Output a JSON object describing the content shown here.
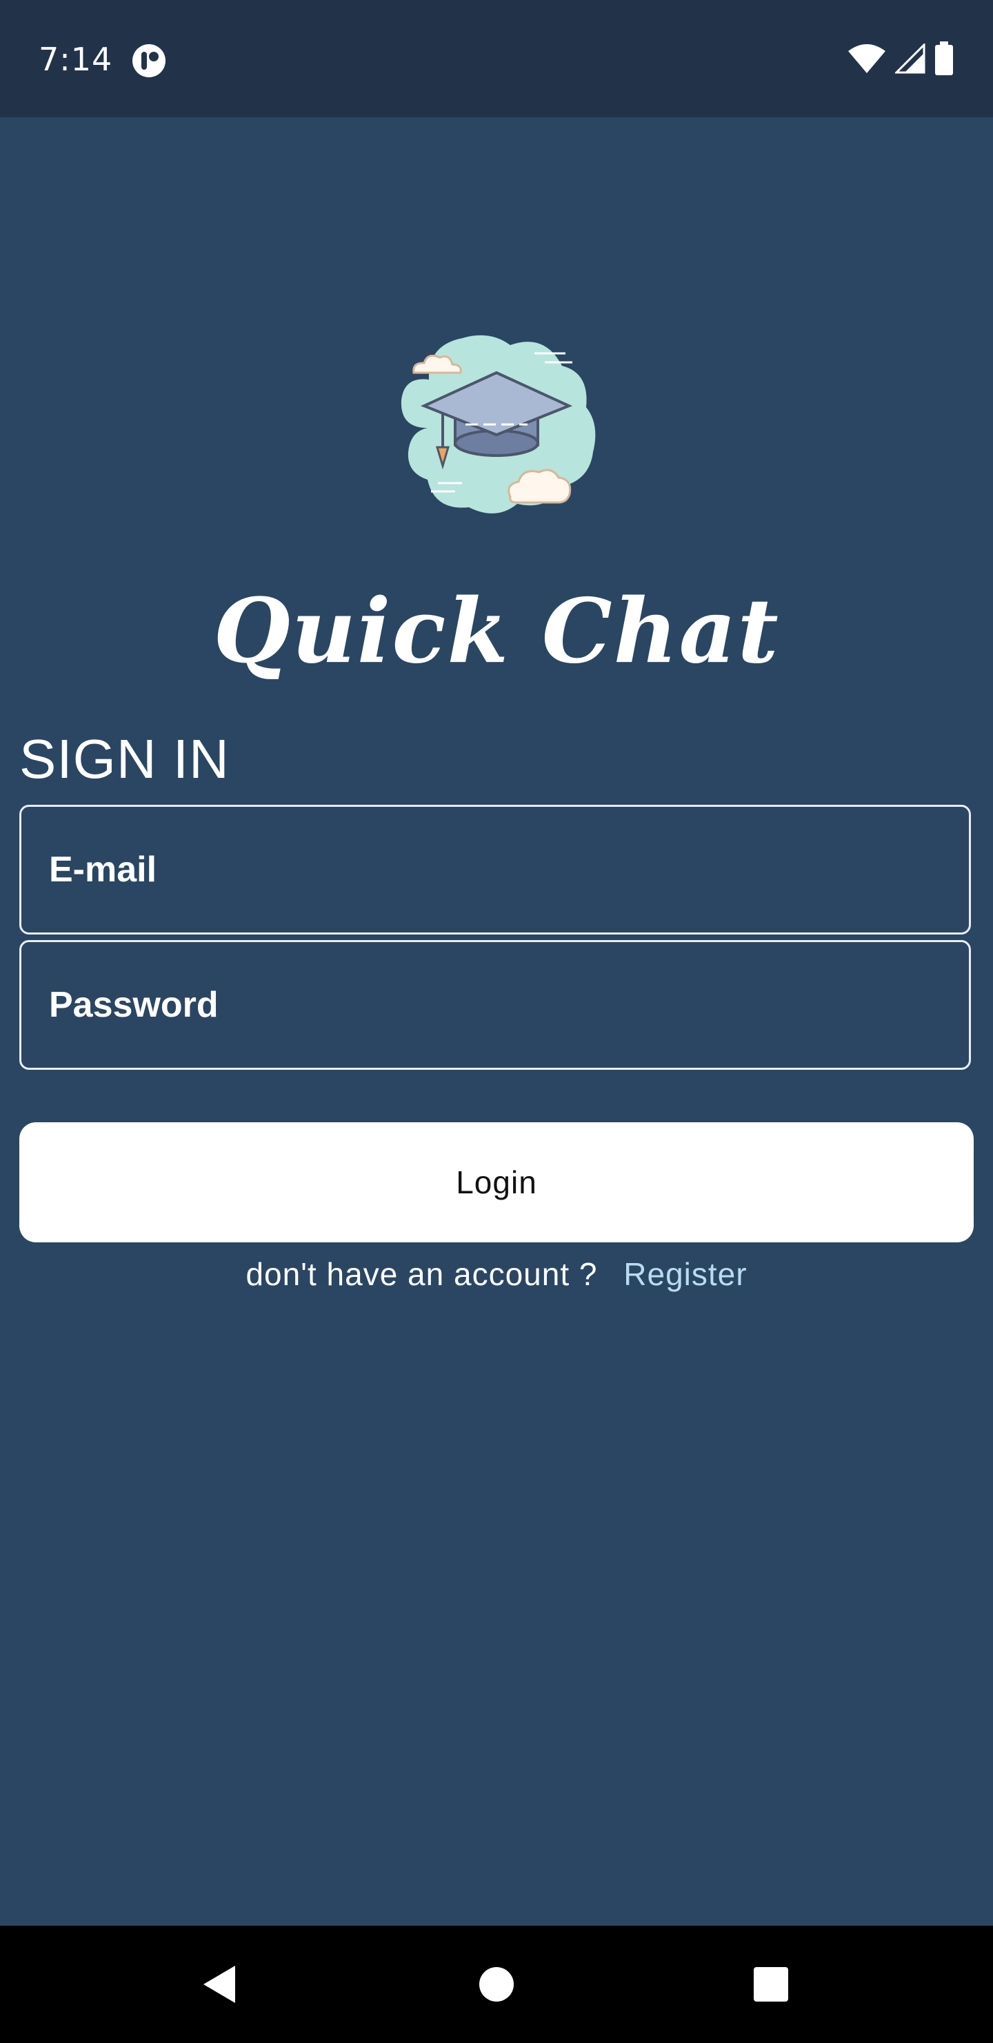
{
  "status_bar": {
    "time": "7:14",
    "icons": [
      "app-indicator-icon",
      "wifi-icon",
      "cellular-signal-icon",
      "battery-icon"
    ]
  },
  "app": {
    "logo_icon": "graduation-cap-icon",
    "title": "Quick Chat"
  },
  "form": {
    "heading": "SIGN IN",
    "email_placeholder": "E-mail",
    "password_placeholder": "Password",
    "login_label": "Login"
  },
  "register": {
    "prompt": "don't have an account ?",
    "link_label": "Register"
  },
  "nav_bar": {
    "icons": [
      "back-icon",
      "home-icon",
      "recents-icon"
    ]
  },
  "colors": {
    "background": "#2a4663",
    "status_bar": "#223349",
    "button": "#ffffff",
    "link": "#b9dcf0"
  }
}
